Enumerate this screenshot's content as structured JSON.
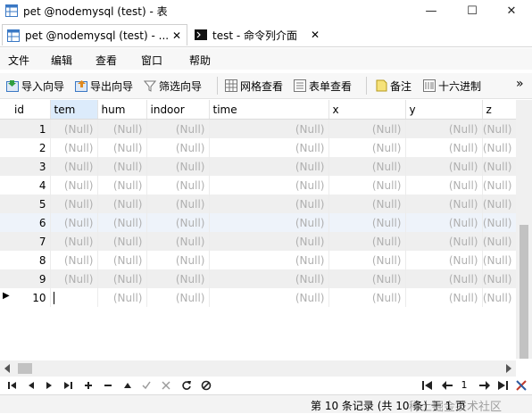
{
  "window": {
    "title": "pet @nodemysql (test) - 表",
    "minimize": "—",
    "maximize": "☐",
    "close": "✕"
  },
  "tabs": [
    {
      "label": "pet @nodemysql (test) - ...",
      "close": "✕"
    },
    {
      "label": "test - 命令列介面",
      "close": "✕"
    }
  ],
  "menu": [
    "文件",
    "编辑",
    "查看",
    "窗口",
    "帮助"
  ],
  "toolbar": {
    "import": "导入向导",
    "export": "导出向导",
    "filter": "筛选向导",
    "grid_view": "网格查看",
    "form_view": "表单查看",
    "memo": "备注",
    "hex": "十六进制",
    "more": "»"
  },
  "grid": {
    "columns": [
      "id",
      "tem",
      "hum",
      "indoor",
      "time",
      "x",
      "y",
      "z"
    ],
    "null_text": "(Null)",
    "rows": [
      {
        "id": "1"
      },
      {
        "id": "2"
      },
      {
        "id": "3"
      },
      {
        "id": "4"
      },
      {
        "id": "5"
      },
      {
        "id": "6"
      },
      {
        "id": "7"
      },
      {
        "id": "8"
      },
      {
        "id": "9"
      },
      {
        "id": "10"
      }
    ],
    "current_row_marker": "▶"
  },
  "navigator": {
    "page": "1"
  },
  "status": {
    "text": "第 10 条记录 (共 10 条) 于 1 页",
    "watermark": "稀土掘金技术社区"
  }
}
